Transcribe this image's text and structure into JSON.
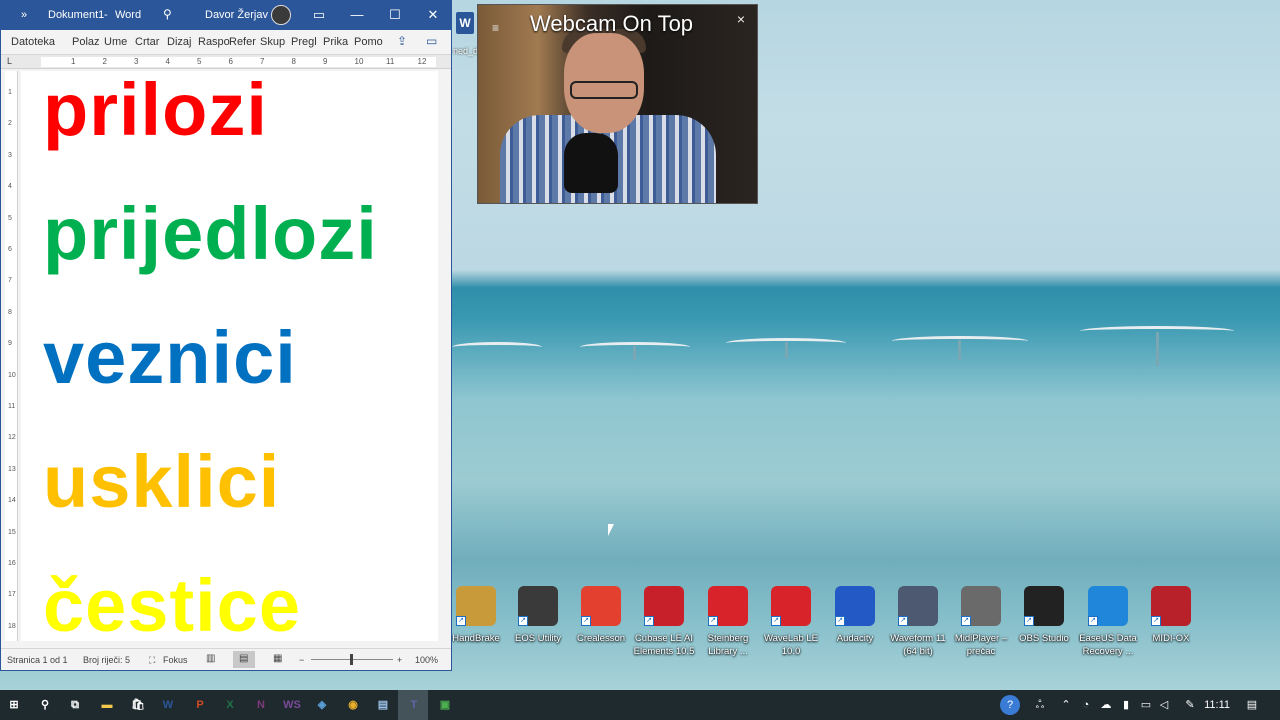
{
  "word": {
    "overflow": "»",
    "doc_title": "Dokument1",
    "separator": "-",
    "app_name": "Word",
    "user": "Davor Žerjav",
    "tabs": [
      "Datoteka",
      "Polaz",
      "Ume",
      "Crtar",
      "Dizaj",
      "Raspo",
      "Refer",
      "Skup",
      "Pregl",
      "Prika",
      "Pomo"
    ],
    "ruler_numbers": [
      "1",
      "2",
      "3",
      "4",
      "5",
      "6",
      "7",
      "8",
      "9",
      "10",
      "11",
      "12"
    ],
    "vruler_numbers": [
      "1",
      "2",
      "3",
      "4",
      "5",
      "6",
      "7",
      "8",
      "9",
      "10",
      "11",
      "12",
      "13",
      "14",
      "15",
      "16",
      "17",
      "18"
    ],
    "words": [
      {
        "text": "prilozi",
        "color": "#ff0000"
      },
      {
        "text": "prijedlozi",
        "color": "#00b050"
      },
      {
        "text": "veznici",
        "color": "#0070c0"
      },
      {
        "text": "usklici",
        "color": "#ffc000"
      },
      {
        "text": "čestice",
        "color": "#ffff00"
      }
    ],
    "status": {
      "page": "Stranica 1 od 1",
      "words": "Broj riječi: 5",
      "focus": "Fokus",
      "zoom": "100%"
    }
  },
  "webcam": {
    "title": "Webcam On Top",
    "close": "×",
    "menu": "≡"
  },
  "desktop_partial_label": "ned_d",
  "desktop_icons": [
    {
      "label": "HandBrake",
      "color": "#c99a3a",
      "icon": "pineapple-icon"
    },
    {
      "label": "EOS Utility",
      "color": "#3a3a3a",
      "icon": "camera-icon"
    },
    {
      "label": "Crealesson",
      "color": "#e3402f",
      "icon": "pencil-icon"
    },
    {
      "label": "Cubase LE AI Elements 10.5",
      "color": "#c8202a",
      "icon": "cubase-icon"
    },
    {
      "label": "Steinberg Library ...",
      "color": "#d8232a",
      "icon": "steinberg-icon"
    },
    {
      "label": "WaveLab LE 10.0",
      "color": "#d8232a",
      "icon": "wavelab-icon"
    },
    {
      "label": "Audacity",
      "color": "#2359c4",
      "icon": "audacity-icon"
    },
    {
      "label": "Waveform 11 (64 bit)",
      "color": "#4d5970",
      "icon": "waveform-icon"
    },
    {
      "label": "MidiPlayer – prečac",
      "color": "#6a6a6a",
      "icon": "piano-icon"
    },
    {
      "label": "OBS Studio",
      "color": "#222222",
      "icon": "obs-icon"
    },
    {
      "label": "EaseUS Data Recovery ...",
      "color": "#1f86d9",
      "icon": "easeus-icon"
    },
    {
      "label": "MIDI-OX",
      "color": "#b8202a",
      "icon": "midiox-icon"
    }
  ],
  "taskbar": {
    "clock": "11:11",
    "apps": [
      {
        "name": "start-icon",
        "glyph": "⊞",
        "color": "#ffffff"
      },
      {
        "name": "search-icon",
        "glyph": "⚲",
        "color": "#ffffff"
      },
      {
        "name": "task-view-icon",
        "glyph": "⧉",
        "color": "#ffffff"
      },
      {
        "name": "file-explorer-icon",
        "glyph": "▬",
        "color": "#f2c94c"
      },
      {
        "name": "store-icon",
        "glyph": "🛍",
        "color": "#ffffff"
      },
      {
        "name": "word-icon",
        "glyph": "W",
        "color": "#2b579a"
      },
      {
        "name": "powerpoint-icon",
        "glyph": "P",
        "color": "#d24726"
      },
      {
        "name": "excel-icon",
        "glyph": "X",
        "color": "#217346"
      },
      {
        "name": "onenote-icon",
        "glyph": "N",
        "color": "#80397b"
      },
      {
        "name": "ws-icon",
        "glyph": "WS",
        "color": "#7a4a9a"
      },
      {
        "name": "generic-app-icon",
        "glyph": "◈",
        "color": "#5aa0d8"
      },
      {
        "name": "chrome-icon",
        "glyph": "◉",
        "color": "#e9b02a"
      },
      {
        "name": "notepad-icon",
        "glyph": "▤",
        "color": "#9ac0e6"
      },
      {
        "name": "teams-icon",
        "glyph": "T",
        "color": "#6264a7"
      },
      {
        "name": "webcam-app-icon",
        "glyph": "▣",
        "color": "#4caf50"
      }
    ]
  },
  "accents": {
    "word_blue": "#2b579a",
    "taskbar": "#1f2a2e"
  }
}
